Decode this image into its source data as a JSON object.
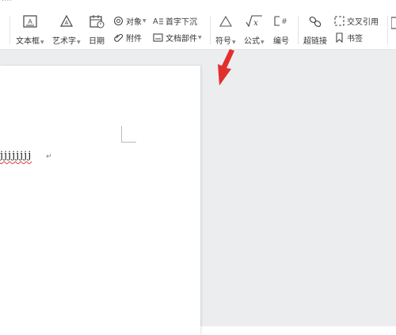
{
  "app": {
    "tab_title": "...."
  },
  "ribbon": {
    "text_box": {
      "label": "文本框"
    },
    "word_art": {
      "label": "艺术字"
    },
    "date": {
      "label": "日期"
    },
    "object": {
      "label": "对象"
    },
    "attachment": {
      "label": "附件"
    },
    "drop_cap": {
      "label": "首字下沉"
    },
    "doc_parts": {
      "label": "文档部件"
    },
    "symbol": {
      "label": "符号"
    },
    "formula": {
      "label": "公式"
    },
    "numbering": {
      "label": "编号"
    },
    "hyperlink": {
      "label": "超链接"
    },
    "cross_ref": {
      "label": "交叉引用"
    },
    "bookmark": {
      "label": "书签"
    }
  },
  "document": {
    "text": "jjjjjjjj"
  },
  "colors": {
    "annotation_arrow": "#e0302e",
    "workspace": "#ecedef",
    "spellcheck": "#e23b3b"
  }
}
